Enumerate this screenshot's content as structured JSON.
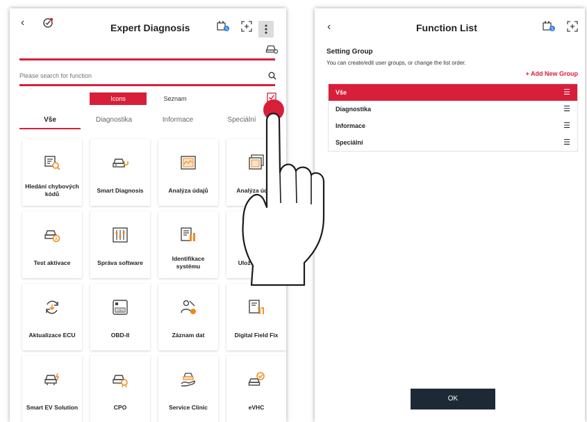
{
  "left_panel": {
    "header": {
      "back": "‹",
      "title": "Expert Diagnosis"
    },
    "search": {
      "placeholder": "Please search for function"
    },
    "view_toggle": {
      "icons_label": "Icons",
      "list_label": "Seznam"
    },
    "tabs": [
      "Vše",
      "Diagnostika",
      "Informace",
      "Speciální"
    ],
    "functions": [
      {
        "label": "Hledání chybových kódů",
        "icon": "dtc-search-icon"
      },
      {
        "label": "Smart Diagnosis",
        "icon": "car-stethoscope-icon"
      },
      {
        "label": "Analýza údajů",
        "icon": "data-chart-icon"
      },
      {
        "label": "Analýza údajů",
        "icon": "data-chart-stack-icon"
      },
      {
        "label": "Test aktivace",
        "icon": "car-actuation-icon"
      },
      {
        "label": "Správa software",
        "icon": "software-sliders-icon"
      },
      {
        "label": "Identifikace systému",
        "icon": "system-id-icon"
      },
      {
        "label": "Uložená data",
        "icon": "saved-folder-icon"
      },
      {
        "label": "Aktualizace ECU",
        "icon": "ecu-update-icon"
      },
      {
        "label": "OBD-II",
        "icon": "obd-box-icon"
      },
      {
        "label": "Záznam dat",
        "icon": "data-record-icon"
      },
      {
        "label": "Digital Field Fix",
        "icon": "field-fix-icon"
      },
      {
        "label": "Smart EV Solution",
        "icon": "ev-car-icon"
      },
      {
        "label": "CPO",
        "icon": "cpo-car-icon"
      },
      {
        "label": "Service Clinic",
        "icon": "service-hand-icon"
      },
      {
        "label": "eVHC",
        "icon": "vhc-check-icon"
      }
    ]
  },
  "right_panel": {
    "header": {
      "back": "‹",
      "title": "Function List"
    },
    "setting_group": {
      "title": "Setting Group",
      "description": "You can create/edit user groups, or change the list order.",
      "add_new_label": "+ Add New Group"
    },
    "groups": [
      {
        "label": "Vše",
        "active": true
      },
      {
        "label": "Diagnostika",
        "active": false
      },
      {
        "label": "Informace",
        "active": false
      },
      {
        "label": "Speciální",
        "active": false
      }
    ],
    "ok_label": "OK"
  },
  "colors": {
    "accent": "#d81f3a",
    "ok_button": "#1d2a36",
    "icon_orange": "#f08a1c"
  }
}
